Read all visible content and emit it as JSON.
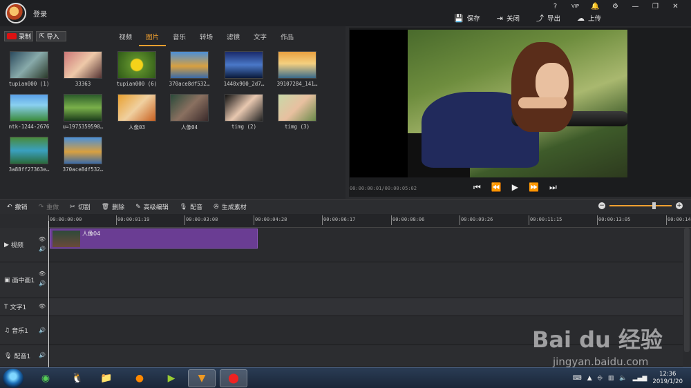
{
  "titlebar": {
    "login": "登录",
    "sys": [
      "?",
      "VIP",
      "🔔",
      "⚙",
      "—",
      "❐",
      "✕"
    ],
    "actions": [
      {
        "icon": "save-icon",
        "label": "保存"
      },
      {
        "icon": "close-icon",
        "label": "关闭"
      },
      {
        "icon": "export-icon",
        "label": "导出"
      },
      {
        "icon": "upload-icon",
        "label": "上传"
      }
    ]
  },
  "library": {
    "record_label": "录制",
    "import_label": "导入",
    "tabs": [
      "视频",
      "图片",
      "音乐",
      "转场",
      "滤镜",
      "文字",
      "作品"
    ],
    "active_tab": "图片",
    "items": [
      {
        "caption": "tupian000 (1)"
      },
      {
        "caption": "33363"
      },
      {
        "caption": "tupian000 (6)"
      },
      {
        "caption": "370ace8df532…"
      },
      {
        "caption": "1440x900_2d7…"
      },
      {
        "caption": "39107284_141…"
      },
      {
        "caption": "ntk-1244-2676"
      },
      {
        "caption": "u=1975359590…"
      },
      {
        "caption": "人像03"
      },
      {
        "caption": "人像04"
      },
      {
        "caption": "timg (2)"
      },
      {
        "caption": "timg (3)"
      },
      {
        "caption": "3a88ff27363e…"
      },
      {
        "caption": "370ace8df532…"
      }
    ]
  },
  "preview": {
    "timecode": "00:00:00:01/00:00:05:02",
    "controls": [
      "⏮",
      "⏪",
      "▶",
      "⏩",
      "⏭"
    ]
  },
  "toolbar": {
    "undo": "撤销",
    "redo": "重做",
    "cut": "切割",
    "delete": "删除",
    "advanced": "高级编辑",
    "dub": "配音",
    "generate": "生成素材",
    "zoom_minus": "−",
    "zoom_plus": "+"
  },
  "timeline": {
    "ticks": [
      "00:00:00:00",
      "00:00:01:19",
      "00:00:03:08",
      "00:00:04:28",
      "00:00:06:17",
      "00:00:08:06",
      "00:00:09:26",
      "00:00:11:15",
      "00:00:13:05",
      "00:00:14:"
    ],
    "tracks": [
      {
        "label": "视频",
        "icon": "play-icon"
      },
      {
        "label": "画中画1",
        "icon": "pip-icon"
      },
      {
        "label": "文字1",
        "icon": "text-icon"
      },
      {
        "label": "音乐1",
        "icon": "music-icon"
      },
      {
        "label": "配音1",
        "icon": "mic-icon"
      }
    ],
    "clip_label": "人像04"
  },
  "taskbar": {
    "time": "12:36",
    "date": "2019/1/20"
  },
  "watermark": {
    "brand": "Bai du 经验",
    "url": "jingyan.baidu.com"
  }
}
